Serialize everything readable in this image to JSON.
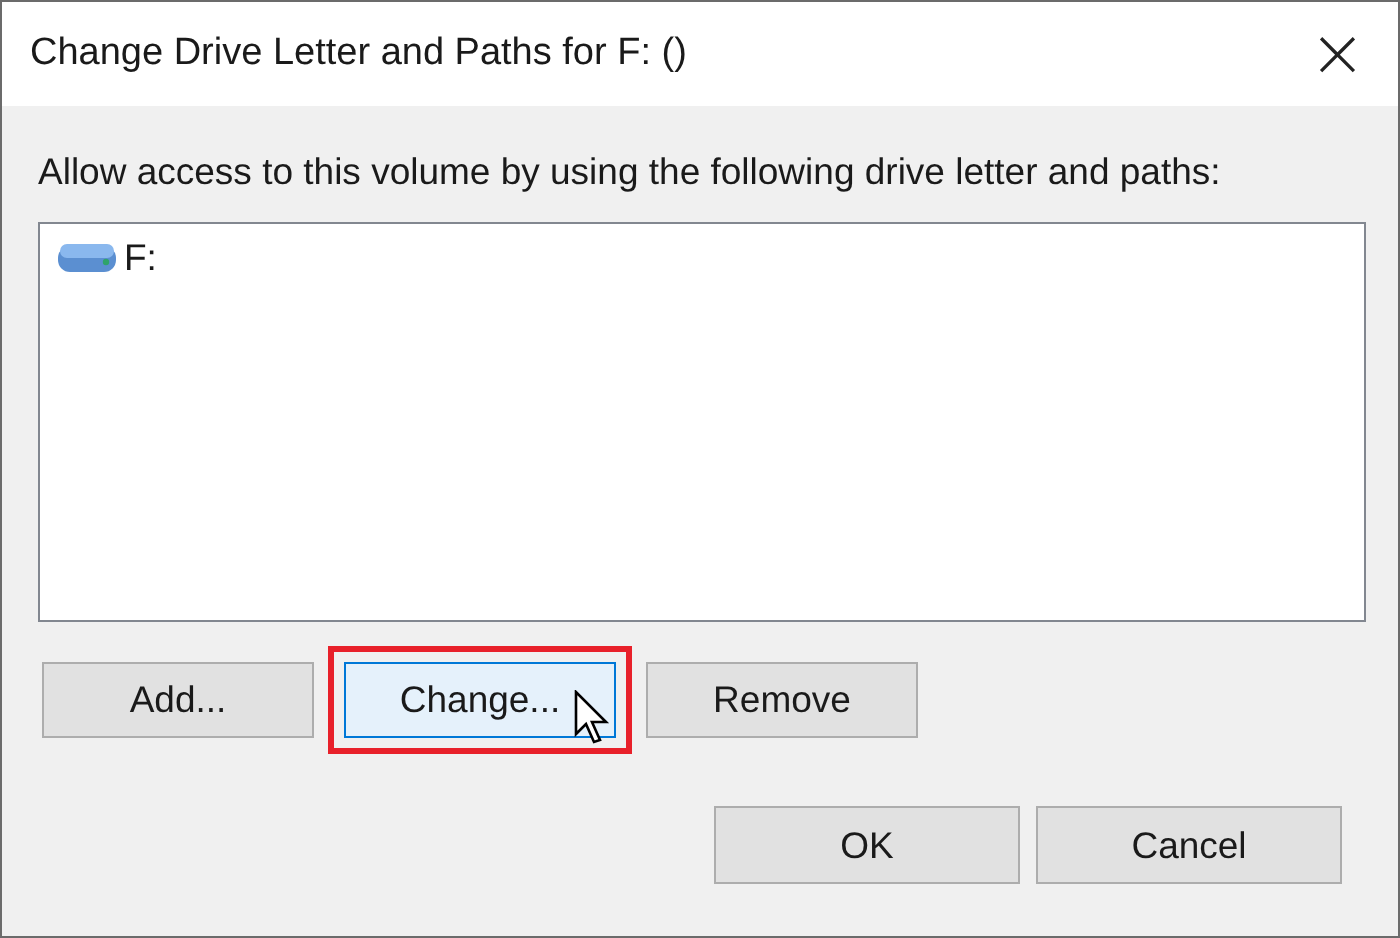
{
  "window": {
    "title": "Change Drive Letter and Paths for F: ()",
    "close": "×"
  },
  "instruction": "Allow access to this volume by using the following drive letter and paths:",
  "paths": [
    {
      "label": "F:",
      "kind": "drive"
    }
  ],
  "actions": [
    {
      "label": "Add...",
      "hovered": false,
      "highlighted": false
    },
    {
      "label": "Change...",
      "hovered": true,
      "highlighted": true
    },
    {
      "label": "Remove",
      "hovered": false,
      "highlighted": false
    }
  ],
  "buttons": [
    {
      "label": "OK"
    },
    {
      "label": "Cancel"
    }
  ]
}
